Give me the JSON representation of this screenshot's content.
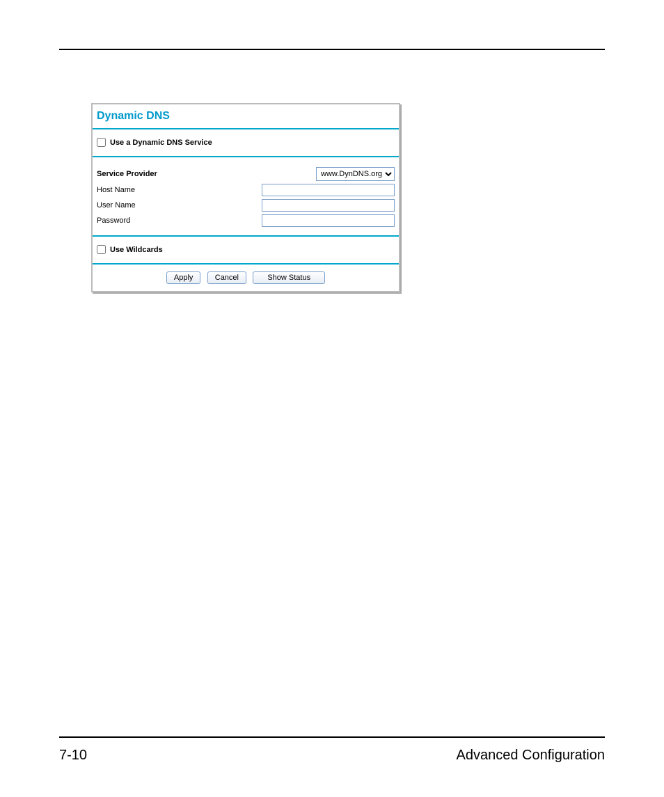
{
  "footer": {
    "page_number": "7-10",
    "section": "Advanced Configuration"
  },
  "panel": {
    "title": "Dynamic DNS",
    "use_service_label": "Use a Dynamic DNS Service",
    "use_service_checked": false,
    "service_provider_label": "Service Provider",
    "service_provider_value": "www.DynDNS.org",
    "host_name_label": "Host Name",
    "host_name_value": "",
    "user_name_label": "User Name",
    "user_name_value": "",
    "password_label": "Password",
    "password_value": "",
    "use_wildcards_label": "Use Wildcards",
    "use_wildcards_checked": false,
    "buttons": {
      "apply": "Apply",
      "cancel": "Cancel",
      "show_status": "Show Status"
    }
  }
}
